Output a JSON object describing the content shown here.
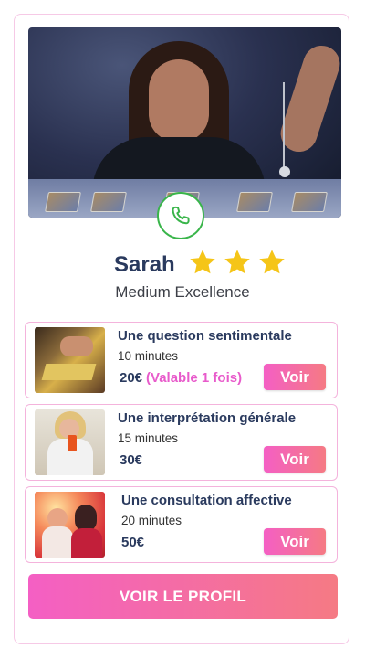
{
  "psychic": {
    "name": "Sarah",
    "title": "Medium Excellence",
    "rating": 3,
    "rating_max": 3
  },
  "offers": [
    {
      "title": "Une question sentimentale",
      "duration": "10 minutes",
      "price": "20€",
      "note": "(Valable 1 fois)",
      "button_label": "Voir"
    },
    {
      "title": "Une interprétation générale",
      "duration": "15 minutes",
      "price": "30€",
      "note": "",
      "button_label": "Voir"
    },
    {
      "title": "Une consultation affective",
      "duration": "20 minutes",
      "price": "50€",
      "note": "",
      "button_label": "Voir"
    }
  ],
  "profile_button_label": "VOIR LE PROFIL",
  "icons": {
    "call": "phone-icon",
    "rating": "star-icon"
  },
  "colors": {
    "brand_gradient_start": "#f45fc4",
    "brand_gradient_end": "#f57a84",
    "name_color": "#2a3a5e",
    "star": "#f5c518",
    "phone_green": "#39b54a",
    "border_pink": "#f4b3dc"
  }
}
